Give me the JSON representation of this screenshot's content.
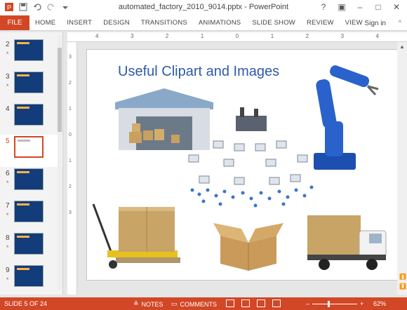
{
  "window": {
    "title": "automated_factory_2010_9014.pptx - PowerPoint"
  },
  "ribbon": {
    "file_label": "FILE",
    "tabs": [
      "HOME",
      "INSERT",
      "DESIGN",
      "TRANSITIONS",
      "ANIMATIONS",
      "SLIDE SHOW",
      "REVIEW",
      "VIEW"
    ],
    "signin": "Sign in"
  },
  "ruler": {
    "h_numbers": [
      "4",
      "3",
      "2",
      "1",
      "0",
      "1",
      "2",
      "3",
      "4"
    ],
    "v_numbers": [
      "3",
      "2",
      "1",
      "0",
      "1",
      "2",
      "3"
    ]
  },
  "thumbnails": [
    {
      "num": "2",
      "star": "*"
    },
    {
      "num": "3",
      "star": "*"
    },
    {
      "num": "4",
      "star": ""
    },
    {
      "num": "5",
      "star": ""
    },
    {
      "num": "6",
      "star": "*"
    },
    {
      "num": "7",
      "star": "*"
    },
    {
      "num": "8",
      "star": "*"
    },
    {
      "num": "9",
      "star": "*"
    }
  ],
  "slide": {
    "title": "Useful Clipart and Images"
  },
  "status": {
    "slide_indicator": "SLIDE 5 OF 24",
    "notes": "NOTES",
    "comments": "COMMENTS",
    "zoom": "62%",
    "zoom_minus": "–",
    "zoom_plus": "+"
  },
  "colors": {
    "accent": "#d24726",
    "title_blue": "#2e5aa8"
  }
}
